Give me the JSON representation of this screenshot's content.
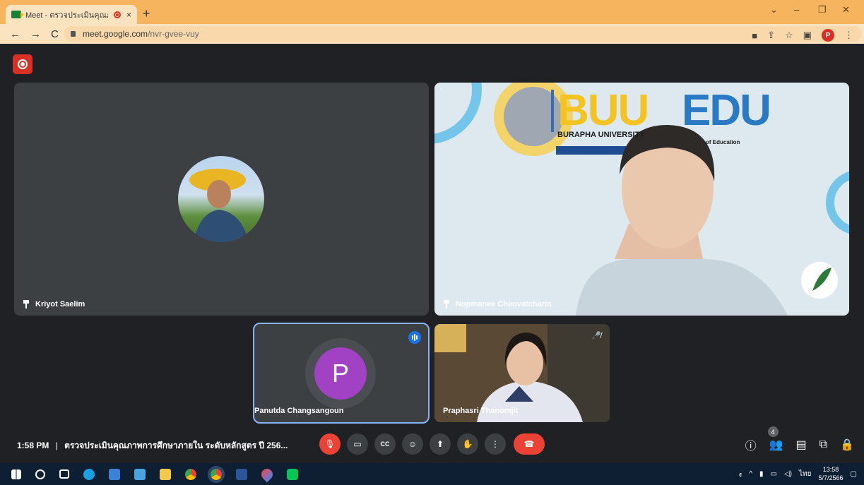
{
  "browser": {
    "tab_title": "Meet - ตรวจประเมินคุณภาพการ",
    "tab_close": "×",
    "new_tab": "+",
    "url_host": "meet.google.com",
    "url_path": "/nvr-gvee-vuy",
    "profile_initial": "P",
    "win_minimize": "–",
    "win_restore": "❐",
    "win_close": "✕",
    "chevron": "⌄"
  },
  "participants": [
    {
      "name": "Kriyot Saelim",
      "pinned": true
    },
    {
      "name": "Nopmanee Chauvatcharin",
      "pinned": true
    },
    {
      "name": "Panutda Changsangoun",
      "initial": "P",
      "speaking": true
    },
    {
      "name": "Praphasri Thanomjit",
      "muted": true
    }
  ],
  "banner": {
    "big1": "BUU",
    "big2": "EDU",
    "univ": "BURAPHA UNIVERSITY",
    "faculty": "of Education"
  },
  "meeting": {
    "time": "1:58 PM",
    "separator": "|",
    "title": "ตรวจประเมินคุณภาพการศึกษาภายใน ระดับหลักสูตร ปี 256...",
    "participant_count": "4"
  },
  "taskbar": {
    "language": "ไทย",
    "time": "13:58",
    "date": "5/7/2566"
  }
}
